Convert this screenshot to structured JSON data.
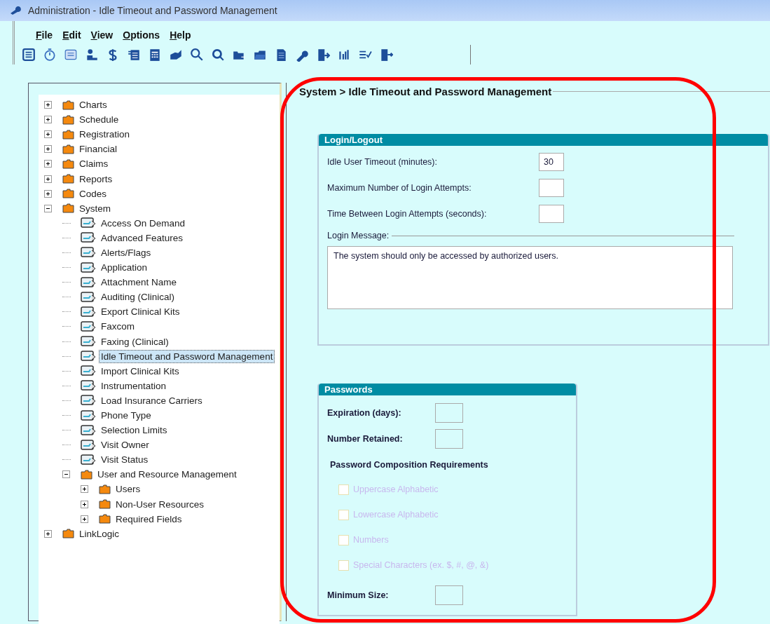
{
  "window": {
    "title": "Administration - Idle Timeout and Password Management"
  },
  "menu": [
    {
      "label": "File"
    },
    {
      "label": "Edit"
    },
    {
      "label": "View"
    },
    {
      "label": "Options"
    },
    {
      "label": "Help"
    }
  ],
  "tree": [
    {
      "label": "Charts",
      "kind": "folder",
      "expanded": false,
      "selected": false
    },
    {
      "label": "Schedule",
      "kind": "folder",
      "expanded": false,
      "selected": false
    },
    {
      "label": "Registration",
      "kind": "folder",
      "expanded": false,
      "selected": false
    },
    {
      "label": "Financial",
      "kind": "folder",
      "expanded": false,
      "selected": false
    },
    {
      "label": "Claims",
      "kind": "folder",
      "expanded": false,
      "selected": false
    },
    {
      "label": "Reports",
      "kind": "folder",
      "expanded": false,
      "selected": false
    },
    {
      "label": "Codes",
      "kind": "folder",
      "expanded": false,
      "selected": false
    },
    {
      "label": "System",
      "kind": "folder",
      "expanded": true,
      "selected": false,
      "children": [
        {
          "label": "Access On Demand",
          "kind": "page",
          "selected": false
        },
        {
          "label": "Advanced Features",
          "kind": "page",
          "selected": false
        },
        {
          "label": "Alerts/Flags",
          "kind": "page",
          "selected": false
        },
        {
          "label": "Application",
          "kind": "page",
          "selected": false
        },
        {
          "label": "Attachment Name",
          "kind": "page",
          "selected": false
        },
        {
          "label": "Auditing (Clinical)",
          "kind": "page",
          "selected": false
        },
        {
          "label": "Export Clinical Kits",
          "kind": "page",
          "selected": false
        },
        {
          "label": "Faxcom",
          "kind": "page",
          "selected": false
        },
        {
          "label": "Faxing (Clinical)",
          "kind": "page",
          "selected": false
        },
        {
          "label": "Idle Timeout and Password Management",
          "kind": "page",
          "selected": true
        },
        {
          "label": "Import Clinical Kits",
          "kind": "page",
          "selected": false
        },
        {
          "label": "Instrumentation",
          "kind": "page",
          "selected": false
        },
        {
          "label": "Load Insurance Carriers",
          "kind": "page",
          "selected": false
        },
        {
          "label": "Phone Type",
          "kind": "page",
          "selected": false
        },
        {
          "label": "Selection Limits",
          "kind": "page",
          "selected": false
        },
        {
          "label": "Visit Owner",
          "kind": "page",
          "selected": false
        },
        {
          "label": "Visit Status",
          "kind": "page",
          "selected": false
        },
        {
          "label": "User and Resource Management",
          "kind": "folder",
          "expanded": true,
          "selected": false,
          "children": [
            {
              "label": "Users",
              "kind": "folder",
              "expanded": false,
              "selected": false
            },
            {
              "label": "Non-User Resources",
              "kind": "folder",
              "expanded": false,
              "selected": false
            },
            {
              "label": "Required Fields",
              "kind": "folder",
              "expanded": false,
              "selected": false
            }
          ]
        }
      ]
    },
    {
      "label": "LinkLogic",
      "kind": "folder",
      "expanded": false,
      "selected": false
    }
  ],
  "breadcrumb": "System > Idle Timeout and Password Management",
  "login_group": {
    "title": "Login/Logout",
    "fields": [
      {
        "label": "Idle User Timeout (minutes):",
        "value": "30"
      },
      {
        "label": "Maximum Number of Login Attempts:"
      },
      {
        "label": "Time Between Login Attempts (seconds):"
      }
    ],
    "message_label": "Login Message:",
    "message": "The system should only be accessed by authorized users."
  },
  "password_group": {
    "title": "Passwords",
    "fields": [
      {
        "label": "Expiration (days):"
      },
      {
        "label": "Number Retained:"
      }
    ],
    "composition_title": "Password Composition Requirements",
    "requirements": [
      {
        "label": "Uppercase Alphabetic",
        "checked": false,
        "disabled": true
      },
      {
        "label": "Lowercase Alphabetic",
        "checked": false,
        "disabled": true
      },
      {
        "label": "Numbers",
        "checked": false,
        "disabled": true
      },
      {
        "label": "Special Characters (ex. $, #, @, &)",
        "checked": false,
        "disabled": true
      }
    ],
    "min_size_field": {
      "label": "Minimum Size:"
    }
  }
}
